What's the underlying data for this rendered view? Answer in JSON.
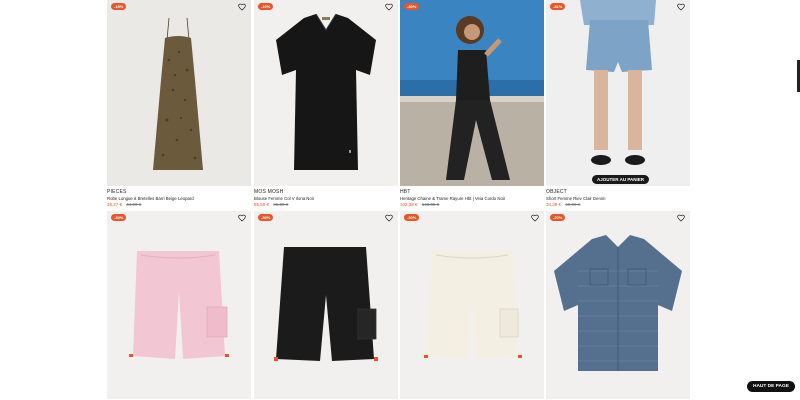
{
  "products": [
    {
      "brand": "PIECES",
      "name": "Robe Longue à Bretelles Barri Beige Léopard",
      "price": "38,27 €",
      "old_price": "44,99 €",
      "badge": "-15%"
    },
    {
      "brand": "MOS MOSH",
      "name": "Blouse Femme Col V Ilona Noir",
      "price": "85,50 €",
      "old_price": "95,00 €",
      "badge": "-10%"
    },
    {
      "brand": "HBT",
      "name": "Heritage Chaine & Trame Rayure Hbt | Veia Cordo Noir",
      "price": "102,38 €",
      "old_price": "146,85 €",
      "badge": "-30%"
    },
    {
      "brand": "OBJECT",
      "name": "Short Femme Riev Clair Denim",
      "price": "34,39 €",
      "old_price": "49,99 €",
      "badge": "-31%"
    },
    {
      "brand": "",
      "name": "",
      "price": "",
      "old_price": "",
      "badge": "-30%"
    },
    {
      "brand": "",
      "name": "",
      "price": "",
      "old_price": "",
      "badge": "-30%"
    },
    {
      "brand": "",
      "name": "",
      "price": "",
      "old_price": "",
      "badge": "-30%"
    },
    {
      "brand": "",
      "name": "",
      "price": "",
      "old_price": "",
      "badge": "-20%"
    }
  ],
  "add_to_cart_label": "AJOUTER AU PANIER",
  "back_to_top_label": "HAUT DE PAGE",
  "icons": {
    "favorite": "heart-icon"
  },
  "colors": {
    "accent": "#e5572a",
    "dark": "#1a1a1a"
  }
}
